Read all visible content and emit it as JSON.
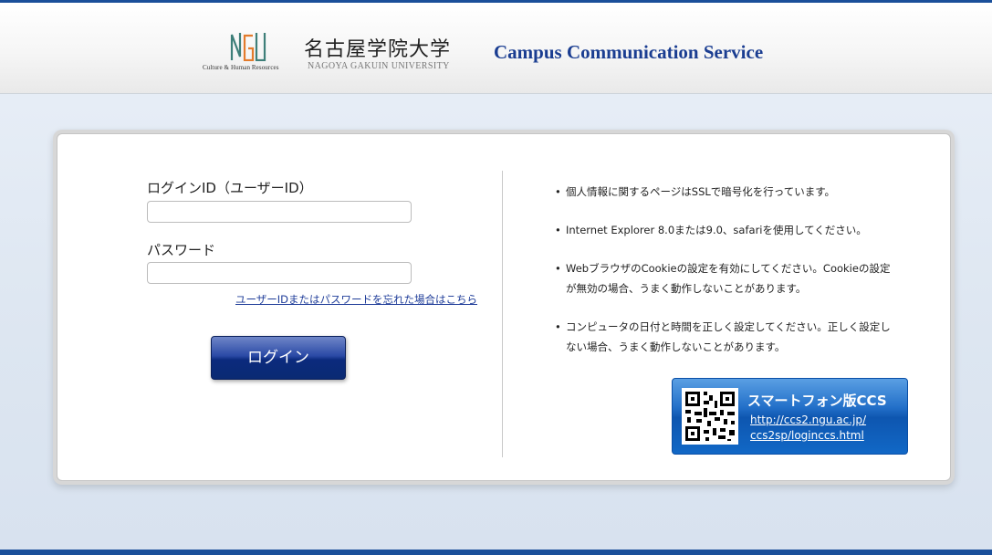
{
  "header": {
    "logo_subtitle": "Culture & Human Resources",
    "university_name": "名古屋学院大学",
    "university_name_en": "NAGOYA GAKUIN UNIVERSITY",
    "service_title": "Campus Communication Service"
  },
  "login": {
    "id_label": "ログインID（ユーザーID）",
    "id_value": "",
    "password_label": "パスワード",
    "password_value": "",
    "forgot_link": "ユーザーIDまたはパスワードを忘れた場合はこちら",
    "login_button": "ログイン"
  },
  "notices": [
    "個人情報に関するページはSSLで暗号化を行っています。",
    "Internet Explorer 8.0または9.0、safariを使用してください。",
    "WebブラウザのCookieの設定を有効にしてください。Cookieの設定が無効の場合、うまく動作しないことがあります。",
    "コンピュータの日付と時間を正しく設定してください。正しく設定しない場合、うまく動作しないことがあります。"
  ],
  "smartphone_banner": {
    "title": "スマートフォン版CCS",
    "url_line1": "http://ccs2.ngu.ac.jp/",
    "url_line2": "ccs2sp/loginccs.html"
  },
  "colors": {
    "brand_blue": "#1a3d91",
    "accent_line": "#1a4f9a",
    "login_button": "#0b2a7d",
    "banner_blue": "#0e56b0",
    "logo_teal": "#3e7f79",
    "logo_orange": "#e37b2c"
  }
}
